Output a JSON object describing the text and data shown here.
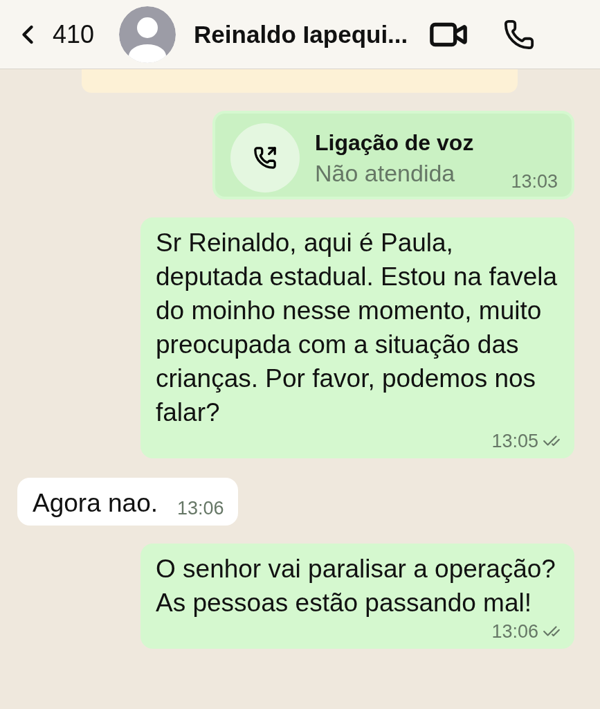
{
  "header": {
    "back_count": "410",
    "contact_name": "Reinaldo Iapequi..."
  },
  "messages": [
    {
      "kind": "call",
      "outgoing": true,
      "title": "Ligação de voz",
      "subtitle": "Não atendida",
      "time": "13:03",
      "delivered": false
    },
    {
      "kind": "text",
      "outgoing": true,
      "text": "Sr Reinaldo, aqui é Paula, deputada estadual. Estou na favela do moinho nesse momento, muito preocupada com a situação das crianças. Por favor, podemos nos falar?",
      "time": "13:05",
      "delivered": true
    },
    {
      "kind": "text",
      "outgoing": false,
      "text": "Agora nao.",
      "time": "13:06",
      "delivered": false
    },
    {
      "kind": "text",
      "outgoing": true,
      "text": "O senhor vai paralisar a operação? As pessoas estão passando mal!",
      "time": "13:06",
      "delivered": true
    }
  ]
}
